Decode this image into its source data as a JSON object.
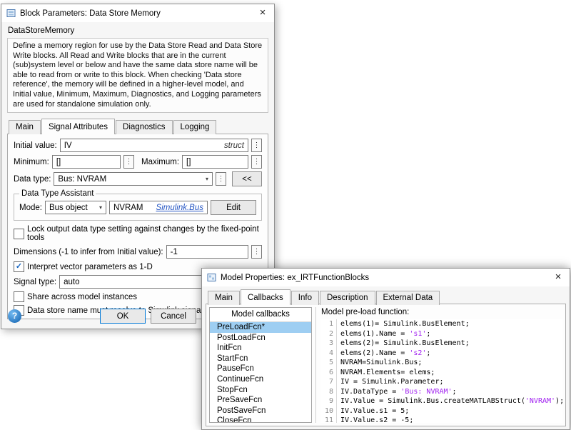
{
  "icons": {
    "dots": "⋮",
    "chevron": "▾",
    "check": "✓",
    "close": "×",
    "help": "?"
  },
  "block_dialog": {
    "title": "Block Parameters: Data Store Memory",
    "section_title": "DataStoreMemory",
    "description": "Define a memory region for use by the Data Store Read and Data Store Write blocks. All Read and Write blocks that are in the current (sub)system level or below and have the same data store name will be able to read from or write to this block. When checking 'Data store reference', the memory will be defined in a higher-level model, and Initial value, Minimum, Maximum, Diagnostics, and Logging parameters are used for standalone simulation only.",
    "tabs": [
      {
        "label": "Main",
        "active": false
      },
      {
        "label": "Signal Attributes",
        "active": true
      },
      {
        "label": "Diagnostics",
        "active": false
      },
      {
        "label": "Logging",
        "active": false
      }
    ],
    "initial_value": {
      "label": "Initial value:",
      "value": "IV",
      "type_hint": "struct"
    },
    "minimum": {
      "label": "Minimum:",
      "value": "[]"
    },
    "maximum": {
      "label": "Maximum:",
      "value": "[]"
    },
    "data_type": {
      "label": "Data type:",
      "value": "Bus: NVRAM",
      "collapse_button": "<<"
    },
    "assistant": {
      "title": "Data Type Assistant",
      "mode_label": "Mode:",
      "mode_value": "Bus object",
      "bus_object_name": "NVRAM",
      "bus_link": "Simulink.Bus",
      "edit_button": "Edit"
    },
    "lock_checkbox": {
      "label": "Lock output data type setting against changes by the fixed-point tools",
      "checked": false
    },
    "dimensions": {
      "label": "Dimensions (-1 to infer from Initial value):",
      "value": "-1"
    },
    "interpret_checkbox": {
      "label": "Interpret vector parameters as 1-D",
      "checked": true
    },
    "signal_type": {
      "label": "Signal type:",
      "value": "auto"
    },
    "share_checkbox": {
      "label": "Share across model instances",
      "checked": false
    },
    "resolve_checkbox": {
      "label": "Data store name must resolve to Simulink signal object",
      "checked": false
    },
    "buttons": {
      "ok": "OK",
      "cancel": "Cancel",
      "help": "Help"
    }
  },
  "model_dialog": {
    "title": "Model Properties: ex_IRTFunctionBlocks",
    "tabs": [
      {
        "label": "Main",
        "active": false
      },
      {
        "label": "Callbacks",
        "active": true
      },
      {
        "label": "Info",
        "active": false
      },
      {
        "label": "Description",
        "active": false
      },
      {
        "label": "External Data",
        "active": false
      }
    ],
    "list_header": "Model callbacks",
    "callbacks": [
      {
        "label": "PreLoadFcn*",
        "selected": true
      },
      {
        "label": "PostLoadFcn",
        "selected": false
      },
      {
        "label": "InitFcn",
        "selected": false
      },
      {
        "label": "StartFcn",
        "selected": false
      },
      {
        "label": "PauseFcn",
        "selected": false
      },
      {
        "label": "ContinueFcn",
        "selected": false
      },
      {
        "label": "StopFcn",
        "selected": false
      },
      {
        "label": "PreSaveFcn",
        "selected": false
      },
      {
        "label": "PostSaveFcn",
        "selected": false
      },
      {
        "label": "CloseFcn",
        "selected": false
      }
    ],
    "code_label": "Model pre-load function:",
    "code_lines": [
      {
        "num": "1",
        "segments": [
          {
            "text": "elems(1)= Simulink.BusElement;",
            "type": "code"
          }
        ]
      },
      {
        "num": "2",
        "segments": [
          {
            "text": "elems(1).Name = ",
            "type": "code"
          },
          {
            "text": "'s1'",
            "type": "string"
          },
          {
            "text": ";",
            "type": "code"
          }
        ]
      },
      {
        "num": "3",
        "segments": [
          {
            "text": "elems(2)= Simulink.BusElement;",
            "type": "code"
          }
        ]
      },
      {
        "num": "4",
        "segments": [
          {
            "text": "elems(2).Name = ",
            "type": "code"
          },
          {
            "text": "'s2'",
            "type": "string"
          },
          {
            "text": ";",
            "type": "code"
          }
        ]
      },
      {
        "num": "5",
        "segments": [
          {
            "text": "NVRAM=Simulink.Bus;",
            "type": "code"
          }
        ]
      },
      {
        "num": "6",
        "segments": [
          {
            "text": "NVRAM.Elements= elems;",
            "type": "code"
          }
        ]
      },
      {
        "num": "7",
        "segments": [
          {
            "text": "IV = Simulink.Parameter;",
            "type": "code"
          }
        ]
      },
      {
        "num": "8",
        "segments": [
          {
            "text": "IV.DataType = ",
            "type": "code"
          },
          {
            "text": "'Bus: NVRAM'",
            "type": "string"
          },
          {
            "text": ";",
            "type": "code"
          }
        ]
      },
      {
        "num": "9",
        "segments": [
          {
            "text": "IV.Value = Simulink.Bus.createMATLABStruct(",
            "type": "code"
          },
          {
            "text": "'NVRAM'",
            "type": "string"
          },
          {
            "text": ");",
            "type": "code"
          }
        ]
      },
      {
        "num": "10",
        "segments": [
          {
            "text": "IV.Value.s1 = 5;",
            "type": "code"
          }
        ]
      },
      {
        "num": "11",
        "segments": [
          {
            "text": "IV.Value.s2 = -5;",
            "type": "code"
          }
        ]
      }
    ]
  }
}
